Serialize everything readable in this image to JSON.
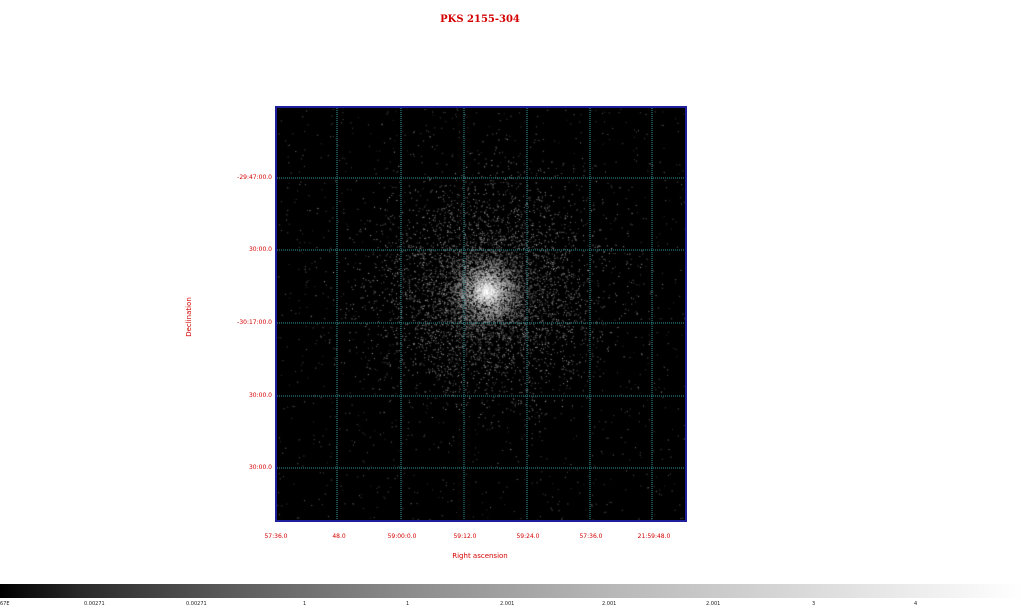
{
  "plot": {
    "title": "PKS 2155-304",
    "xlabel": "Right ascension",
    "ylabel": "Declination",
    "x_ticks": [
      "57:36.0",
      "48.0",
      "59:00:0.0",
      "59:12.0",
      "59:24.0",
      "57:36.0",
      "21:59:48.0"
    ],
    "y_ticks": [
      "-29:47:00.0",
      "30:00.0",
      "-30:17:00.0",
      "30:00.0",
      "30:00.0"
    ],
    "grid_color": "#2f9aa1",
    "text_color": "#d40000"
  },
  "colorbar": {
    "labels": [
      "67E",
      "0.00271",
      "0.00271",
      "1",
      "1",
      "2.001",
      "2.001",
      "2.001",
      "3",
      "4"
    ]
  }
}
